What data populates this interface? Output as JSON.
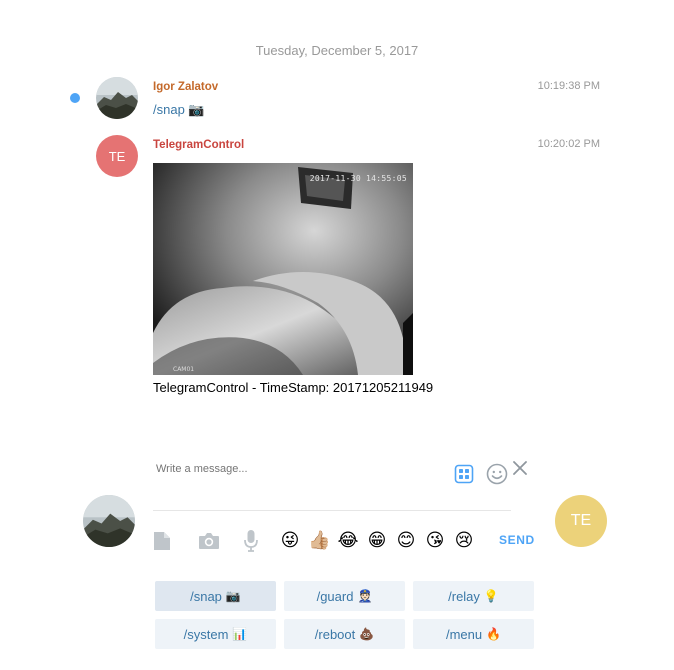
{
  "date_separator": "Tuesday, December 5, 2017",
  "colors": {
    "unread_dot": "#4ea4f6",
    "author_igor": "#c4692a",
    "author_bot": "#c9453f",
    "bot_avatar": "#e57373",
    "self_avatar": "#ecd27a",
    "link": "#3a77a6",
    "send": "#4ea4f6"
  },
  "messages": [
    {
      "author": "Igor Zalatov",
      "time": "10:19:38 PM",
      "text": "/snap 📷",
      "avatar": "photo"
    },
    {
      "author": "TelegramControl",
      "time": "10:20:02 PM",
      "avatar_initials": "TE",
      "photo": {
        "timestamp_overlay": "2017-11-30 14:55:05",
        "camera_label": "CAM01"
      },
      "caption": "TelegramControl - TimeStamp: 20171205211949"
    }
  ],
  "composer": {
    "placeholder": "Write a message...",
    "send_label": "SEND",
    "emojis": [
      "😜",
      "👍🏼",
      "😂",
      "😁",
      "😊",
      "😘",
      "😢"
    ],
    "icons": [
      "document-icon",
      "camera-icon",
      "microphone-icon",
      "bot-keyboard-icon",
      "emoji-smiley-icon",
      "close-icon"
    ],
    "self_avatar_initials": "TE"
  },
  "keyboard": {
    "rows": [
      [
        {
          "label": "/snap",
          "emoji": "📷",
          "active": true
        },
        {
          "label": "/guard",
          "emoji": "👮🏻",
          "active": false
        },
        {
          "label": "/relay",
          "emoji": "💡",
          "active": false
        }
      ],
      [
        {
          "label": "/system",
          "emoji": "📊",
          "active": false
        },
        {
          "label": "/reboot",
          "emoji": "💩",
          "active": false
        },
        {
          "label": "/menu",
          "emoji": "🔥",
          "active": false
        }
      ]
    ]
  }
}
